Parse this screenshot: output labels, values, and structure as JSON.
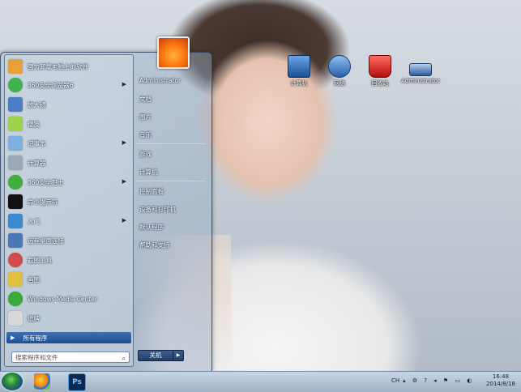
{
  "desktop": {
    "icons": [
      {
        "label": "计算机",
        "icon": "computer-icon"
      },
      {
        "label": "网络",
        "icon": "network-icon"
      },
      {
        "label": "回收站",
        "icon": "recycle-bin-icon"
      },
      {
        "label": "Administrator",
        "icon": "user-folder-icon"
      }
    ]
  },
  "start_menu": {
    "programs": [
      {
        "label": "强力卸载电脑上的软件",
        "icon": "uninstall-icon",
        "color": "#e8a13a"
      },
      {
        "label": "360安全浏览器6",
        "icon": "browser-icon",
        "color": "#3fb34f",
        "submenu": true
      },
      {
        "label": "放大镜",
        "icon": "magnifier-icon",
        "color": "#4a7fc8"
      },
      {
        "label": "便笺",
        "icon": "sticky-notes-icon",
        "color": "#9dd24a"
      },
      {
        "label": "记事本",
        "icon": "notepad-icon",
        "color": "#7fb0e0",
        "submenu": true
      },
      {
        "label": "计算器",
        "icon": "calculator-icon",
        "color": "#9aa8b8"
      },
      {
        "label": "360安全卫士",
        "icon": "security-guard-icon",
        "color": "#3fae3a",
        "submenu": true
      },
      {
        "label": "命令提示符",
        "icon": "command-prompt-icon",
        "color": "#111111"
      },
      {
        "label": "入门",
        "icon": "getting-started-icon",
        "color": "#3a8ad0",
        "submenu": true
      },
      {
        "label": "远程桌面连接",
        "icon": "remote-desktop-icon",
        "color": "#4a78b8"
      },
      {
        "label": "截图工具",
        "icon": "snipping-tool-icon",
        "color": "#d44a4a"
      },
      {
        "label": "画图",
        "icon": "paint-icon",
        "color": "#e0c040"
      },
      {
        "label": "Windows Media Center",
        "icon": "media-center-icon",
        "color": "#3aa83a"
      },
      {
        "label": "纸牌",
        "icon": "solitaire-icon",
        "color": "#d8d8d8"
      }
    ],
    "all_programs": "所有程序",
    "search_placeholder": "搜索程序和文件",
    "right_items": [
      "Administrator",
      "文档",
      "图片",
      "音乐",
      "游戏",
      "计算机",
      "控制面板",
      "设备和打印机",
      "默认程序",
      "帮助和支持"
    ],
    "shutdown": "关机"
  },
  "taskbar": {
    "pinned": [
      "explorer-icon",
      "photoshop-icon"
    ],
    "photoshop_label": "Ps",
    "tray_lang": "CH",
    "time": "16:48",
    "date": "2014/8/18"
  }
}
